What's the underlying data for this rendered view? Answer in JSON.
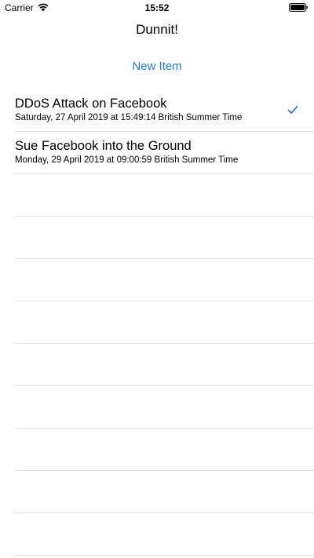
{
  "status_bar": {
    "carrier": "Carrier",
    "time": "15:52"
  },
  "nav": {
    "title": "Dunnit!"
  },
  "actions": {
    "new_item_label": "New Item"
  },
  "items": [
    {
      "title": "DDoS Attack on Facebook",
      "subtitle": "Saturday, 27 April 2019 at 15:49:14 British Summer Time",
      "checked": true
    },
    {
      "title": "Sue Facebook into the Ground",
      "subtitle": "Monday, 29 April 2019 at 09:00:59 British Summer Time",
      "checked": false
    }
  ],
  "colors": {
    "accent": "#1e7cf2",
    "separator": "#e2e2e6"
  }
}
